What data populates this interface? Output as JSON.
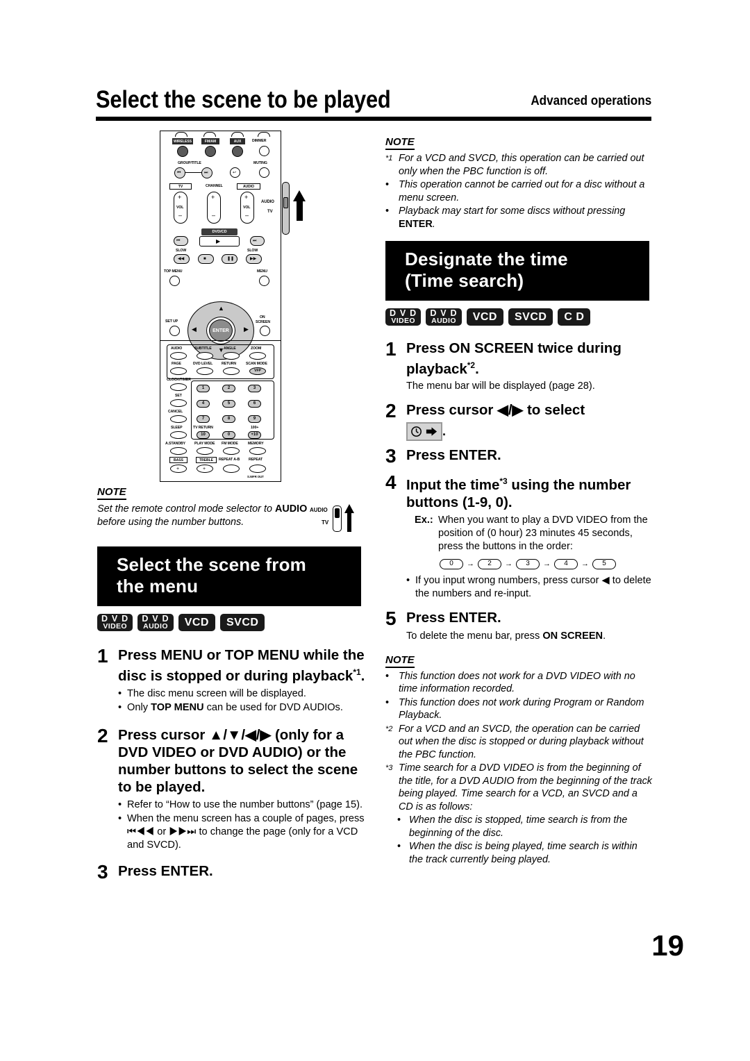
{
  "header": {
    "title": "Select the scene to be played",
    "right_label": "Advanced operations"
  },
  "page_number": "19",
  "remote": {
    "labels": {
      "wireless": "WIRELESS",
      "fm_am": "FM/AM",
      "aux": "AUX",
      "dimmer": "DIMMER",
      "group_title": "GROUP/TITLE",
      "muting": "MUTING",
      "tv": "TV",
      "channel": "CHANNEL",
      "audio": "AUDIO",
      "vol_left": "VOL",
      "vol_right": "VOL",
      "dvd_cd": "DVD/CD",
      "slow_minus": "SLOW",
      "slow_plus": "SLOW",
      "top_menu": "TOP MENU",
      "menu": "MENU",
      "enter": "ENTER",
      "set_up": "SET UP",
      "on_screen": "ON SCREEN",
      "audio_btn": "AUDIO",
      "subtitle": "SUBTITLE",
      "angle": "ANGLE",
      "zoom": "ZOOM",
      "page": "PAGE",
      "dvd_level": "DVD LEVEL",
      "return": "RETURN",
      "scan_mode": "SCAN MODE",
      "vfp": "VFP",
      "clock_timer": "CLOCK/TIMER",
      "set": "SET",
      "cancel": "CANCEL",
      "sleep": "SLEEP",
      "tv_return": "TV RETURN",
      "hundred_plus": "100+",
      "a_standby": "A.STANDBY",
      "play_mode": "PLAY MODE",
      "fm_mode": "FM MODE",
      "memory": "MEMORY",
      "bass": "BASS",
      "treble": "TREBLE",
      "repeat_ab": "REPEAT A-B",
      "repeat": "REPEAT",
      "subwoofer_out": "S.WFR OUT",
      "mode_audio": "AUDIO",
      "mode_tv": "TV"
    },
    "numbers": [
      "1",
      "2",
      "3",
      "4",
      "5",
      "6",
      "7",
      "8",
      "9",
      "10",
      "0",
      "+10"
    ]
  },
  "left_note": {
    "heading": "NOTE",
    "line1": "Set the remote control mode selector to",
    "bold": "AUDIO",
    "line2": " before using the number buttons.",
    "selector_audio": "AUDIO",
    "selector_tv": "TV"
  },
  "section_menu": {
    "banner_line1": "Select the scene from",
    "banner_line2": "the menu",
    "badges": [
      {
        "l1": "D V D",
        "l2": "VIDEO"
      },
      {
        "l1": "D V D",
        "l2": "AUDIO"
      },
      {
        "single": "VCD"
      },
      {
        "single": "SVCD"
      }
    ],
    "steps": [
      {
        "num": "1",
        "text": "Press MENU or TOP MENU while the disc is stopped or during playback",
        "sup": "*1",
        "tail": ".",
        "bullets": [
          {
            "pre": "The disc menu screen will be displayed.",
            "bold": "",
            "post": ""
          },
          {
            "pre": "Only ",
            "bold": "TOP MENU",
            "post": " can be used for DVD AUDIOs."
          }
        ]
      },
      {
        "num": "2",
        "text": "Press cursor ▲/▼/◀/▶ (only for a DVD VIDEO or DVD AUDIO) or the number buttons to select the scene to be played.",
        "sup": "",
        "tail": "",
        "bullets": [
          {
            "pre": "Refer to “How to use the number buttons” (page 15).",
            "bold": "",
            "post": ""
          },
          {
            "pre": "When the menu screen has a couple of pages, press ⏮◀◀ or ▶▶⏭ to change the page (only for a VCD and SVCD).",
            "bold": "",
            "post": ""
          }
        ]
      },
      {
        "num": "3",
        "text": "Press ENTER.",
        "sup": "",
        "tail": "",
        "bullets": []
      }
    ]
  },
  "right_note_top": {
    "heading": "NOTE",
    "items": [
      {
        "marker": "*1",
        "text": "For a VCD and SVCD, this operation can be carried out only when the PBC function is off."
      },
      {
        "marker": "•",
        "text": "This operation cannot be carried out for a disc without a menu screen."
      },
      {
        "marker": "•",
        "text": "Playback may start for some discs without pressing ",
        "bold": "ENTER",
        "post": "."
      }
    ]
  },
  "section_time": {
    "banner_line1": "Designate the time",
    "banner_line2": "(Time search)",
    "badges": [
      {
        "l1": "D V D",
        "l2": "VIDEO"
      },
      {
        "l1": "D V D",
        "l2": "AUDIO"
      },
      {
        "single": "VCD"
      },
      {
        "single": "SVCD"
      },
      {
        "single": "C D"
      }
    ],
    "steps": [
      {
        "num": "1",
        "text": "Press ON SCREEN twice during playback",
        "sup": "*2",
        "tail": ".",
        "sub": "The menu bar will be displayed (page 28)."
      },
      {
        "num": "2",
        "text": "Press cursor ◀/▶ to select",
        "icon_name": "time-search-icon",
        "tail": "."
      },
      {
        "num": "3",
        "text": "Press ENTER."
      },
      {
        "num": "4",
        "text": "Input the time",
        "sup": "*3",
        "tail": " using the number buttons (1-9, 0).",
        "example_label": "Ex.:",
        "example_text": "When you want to play a DVD VIDEO from the position of (0 hour) 23 minutes 45 seconds, press the buttons in the order:",
        "sequence": [
          "0",
          "2",
          "3",
          "4",
          "5"
        ],
        "bullet": "If you input wrong numbers, press cursor ◀ to delete the numbers and re-input."
      },
      {
        "num": "5",
        "text": "Press ENTER.",
        "sub_pre": "To delete the menu bar, press ",
        "sub_bold": "ON SCREEN",
        "sub_post": "."
      }
    ]
  },
  "right_note_bottom": {
    "heading": "NOTE",
    "items": [
      {
        "marker": "•",
        "text": "This function does not work for a DVD VIDEO with no time information recorded."
      },
      {
        "marker": "•",
        "text": "This function does not work during Program or Random Playback."
      },
      {
        "marker": "*2",
        "text": "For a VCD and an SVCD, the operation can be carried out when the disc is stopped or during playback without the PBC function."
      },
      {
        "marker": "*3",
        "text": "Time search for a DVD VIDEO is from the beginning of the title, for a DVD AUDIO from the beginning of the track being played. Time search for a VCD, an SVCD and a CD is as follows:"
      }
    ],
    "subitems": [
      {
        "marker": "•",
        "text": "When the disc is stopped, time search is from the beginning of the disc."
      },
      {
        "marker": "•",
        "text": "When the disc is being played, time search is within the track currently being played."
      }
    ]
  },
  "colors": {
    "banner_bg": "#000000",
    "badge_bg": "#1a1a1a",
    "paper": "#ffffff"
  }
}
